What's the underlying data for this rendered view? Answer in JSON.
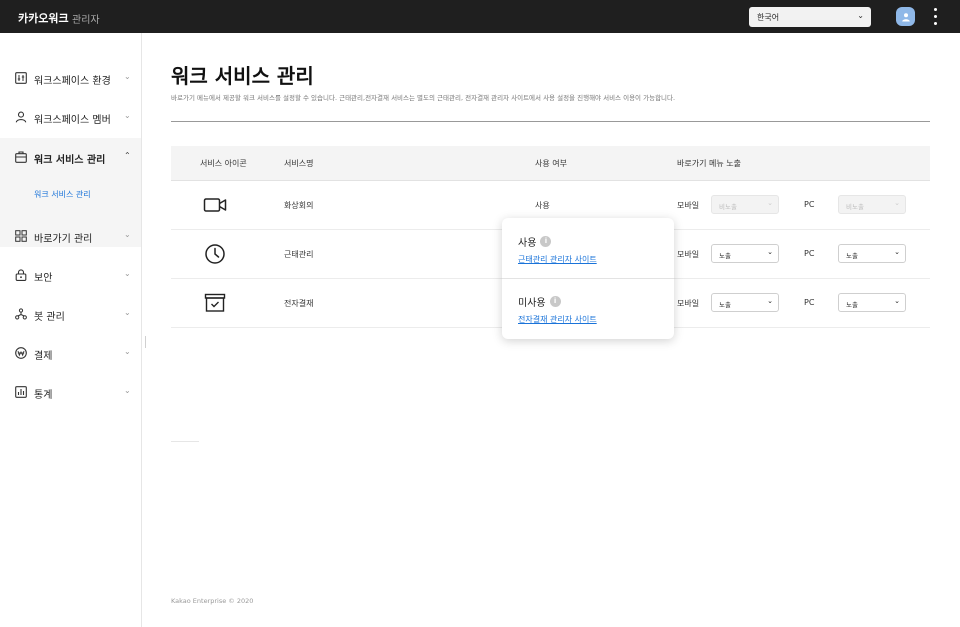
{
  "topbar": {
    "brand": "카카오워크",
    "brand_sub": "관리자",
    "language": "한국어"
  },
  "sidebar": {
    "items": [
      {
        "label": "워크스페이스 환경",
        "icon": "settings-sliders-icon"
      },
      {
        "label": "워크스페이스 멤버",
        "icon": "user-icon"
      },
      {
        "label": "워크 서비스 관리",
        "icon": "briefcase-icon",
        "expanded": true
      },
      {
        "label": "바로가기 관리",
        "icon": "grid-icon"
      },
      {
        "label": "보안",
        "icon": "lock-icon"
      },
      {
        "label": "봇 관리",
        "icon": "bot-icon"
      },
      {
        "label": "결제",
        "icon": "won-coin-icon"
      },
      {
        "label": "통계",
        "icon": "chart-icon"
      }
    ],
    "sub_item": "워크 서비스 관리"
  },
  "main": {
    "title": "워크 서비스 관리",
    "description": "바로가기 메뉴에서 제공할 워크 서비스를 설정할 수 있습니다. 근태관리,전자결재 서비스는 별도의 근태관리, 전자결재 관리자 사이트에서 사용 설정을 진행해야 서비스 이용이 가능합니다.",
    "table": {
      "headers": [
        "서비스 아이콘",
        "서비스명",
        "사용 여부",
        "바로가기 메뉴 노출"
      ],
      "rows": [
        {
          "icon": "video-camera-icon",
          "name": "화상회의",
          "usage": "사용",
          "mobile_label": "모바일",
          "mobile_value": "비노출",
          "pc_label": "PC",
          "pc_value": "비노출",
          "disabled": true
        },
        {
          "icon": "clock-icon",
          "name": "근태관리",
          "usage": "",
          "mobile_label": "모바일",
          "mobile_value": "노출",
          "pc_label": "PC",
          "pc_value": "노출",
          "disabled": false
        },
        {
          "icon": "approval-box-icon",
          "name": "전자결재",
          "usage": "",
          "mobile_label": "모바일",
          "mobile_value": "노출",
          "pc_label": "PC",
          "pc_value": "노출",
          "disabled": false
        }
      ]
    }
  },
  "popover": {
    "items": [
      {
        "status": "사용",
        "link": "근태관리 관리자 사이트"
      },
      {
        "status": "미사용",
        "link": "전자결재 관리자 사이트"
      }
    ]
  },
  "footer": "Kakao Enterprise © 2020",
  "colors": {
    "topbar": "#1f1f1f",
    "link": "#1a73d9",
    "active_bg": "#f5f5f5"
  }
}
